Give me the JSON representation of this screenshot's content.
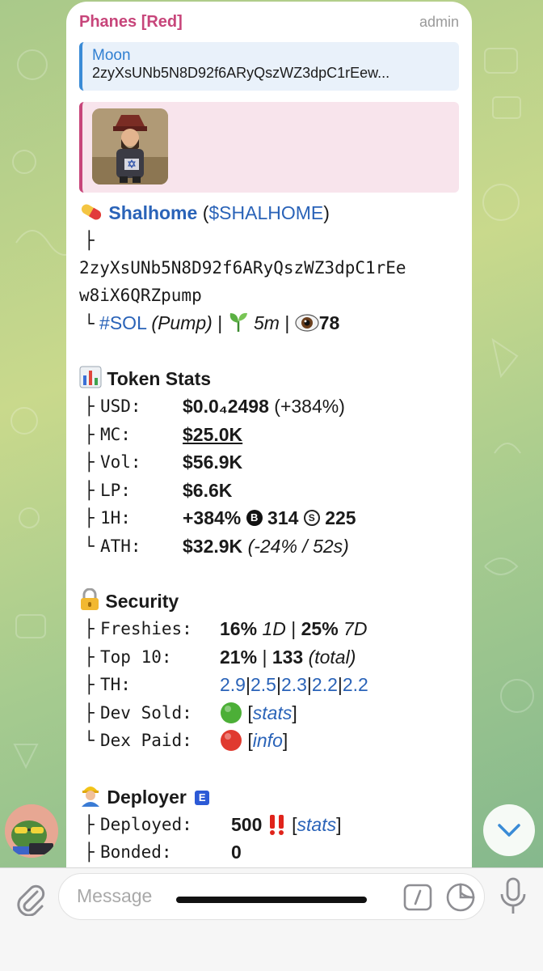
{
  "message": {
    "sender": "Phanes [Red]",
    "role": "admin",
    "reply": {
      "title": "Moon",
      "text": "2zyXsUNb5N8D92f6ARyQszWZ3dpC1rEew..."
    },
    "token": {
      "name": "Shalhome",
      "ticker_open": "(",
      "ticker": "$SHALHOME",
      "ticker_close": ")",
      "tree_branch": "├",
      "address_line1": "2zyXsUNb5N8D92f6ARyQszWZ3dpC1rEe",
      "address_line2": "w8iX6QRZpump",
      "meta": {
        "tree": "└",
        "chain": "#SOL",
        "platform": "(Pump)",
        "sep1": "|",
        "age": "5m",
        "sep2": "|",
        "views": "78"
      }
    },
    "token_stats": {
      "title": "Token Stats",
      "rows": [
        {
          "tree": "├",
          "label": "USD:",
          "value": "$0.0₄2498",
          "extra": "(+384%)"
        },
        {
          "tree": "├",
          "label": "MC:",
          "value": "$25.0K"
        },
        {
          "tree": "├",
          "label": "Vol:",
          "value": "$56.9K"
        },
        {
          "tree": "├",
          "label": "LP:",
          "value": "$6.6K"
        },
        {
          "tree": "├",
          "label": "1H:",
          "value": "+384%",
          "buys": "314",
          "sells": "225"
        },
        {
          "tree": "└",
          "label": "ATH:",
          "value": "$32.9K",
          "extra": "(-24% / 52s)"
        }
      ],
      "badge_buy": "B",
      "badge_sell": "S"
    },
    "security": {
      "title": "Security",
      "rows": [
        {
          "tree": "├",
          "label": "Freshies:",
          "v1": "16%",
          "p1": "1D",
          "sep": "|",
          "v2": "25%",
          "p2": "7D"
        },
        {
          "tree": "├",
          "label": "Top 10:",
          "v1": "21%",
          "sep": "|",
          "v2": "133",
          "p2": "(total)"
        },
        {
          "tree": "├",
          "label": "TH:",
          "holders": [
            "2.9",
            "2.5",
            "2.3",
            "2.2",
            "2.2"
          ],
          "sep": "|"
        },
        {
          "tree": "├",
          "label": "Dev Sold:",
          "link": "stats",
          "open": "[",
          "close": "]",
          "status": "green"
        },
        {
          "tree": "└",
          "label": "Dex Paid:",
          "link": "info",
          "open": "[",
          "close": "]",
          "status": "red"
        }
      ]
    },
    "deployer": {
      "title": "Deployer",
      "badge": "E",
      "rows": [
        {
          "tree": "├",
          "label": "Deployed:",
          "value": "500",
          "link": "stats",
          "open": "[",
          "close": "]"
        },
        {
          "tree": "├",
          "label": "Bonded:",
          "value": "0"
        }
      ]
    }
  },
  "composer": {
    "placeholder": "Message"
  },
  "colors": {
    "sender": "#c7457a",
    "link": "#2a63b8",
    "reply_accent": "#3a8bd6"
  },
  "icons": [
    "pill-icon",
    "seedling-icon",
    "eye-icon",
    "bar-chart-icon",
    "lock-icon",
    "worker-icon",
    "double-exclamation-icon",
    "paperclip-icon",
    "command-icon",
    "sticker-icon",
    "microphone-icon",
    "chevron-down-icon"
  ]
}
